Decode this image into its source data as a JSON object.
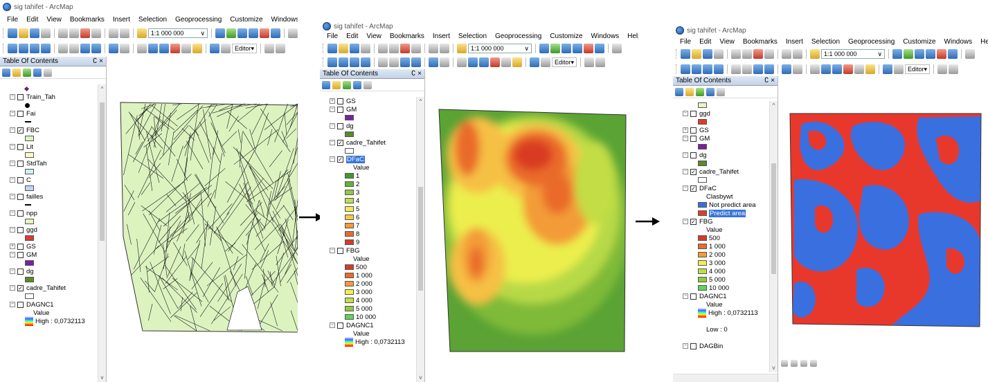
{
  "common": {
    "menu": [
      "File",
      "Edit",
      "View",
      "Bookmarks",
      "Insert",
      "Selection",
      "Geoprocessing",
      "Customize",
      "Windows",
      "Help"
    ],
    "scale": "1:1 000 000",
    "editor": "Editor▾",
    "toc_title": "Table Of Contents",
    "toc_pin": "∁ ×"
  },
  "windows": [
    {
      "title": "sig tahifet - ArcMap",
      "layers": [
        {
          "kind": "sym",
          "sym": "diamond"
        },
        {
          "kind": "layer",
          "pm": "−",
          "checked": false,
          "name": "Train_Tah"
        },
        {
          "kind": "sym",
          "sym": "dot"
        },
        {
          "kind": "layer",
          "pm": "−",
          "checked": false,
          "name": "Fai"
        },
        {
          "kind": "sym",
          "sym": "line"
        },
        {
          "kind": "layer",
          "pm": "−",
          "checked": true,
          "name": "FBC"
        },
        {
          "kind": "sym",
          "color": "#dcf3c0"
        },
        {
          "kind": "layer",
          "pm": "−",
          "checked": false,
          "name": "Lit"
        },
        {
          "kind": "sym",
          "color": "#fdfcc8"
        },
        {
          "kind": "layer",
          "pm": "−",
          "checked": false,
          "name": "StdTah"
        },
        {
          "kind": "sym",
          "color": "#cdeef6"
        },
        {
          "kind": "layer",
          "pm": "−",
          "checked": false,
          "name": "C"
        },
        {
          "kind": "sym",
          "color": "#bcd7f5"
        },
        {
          "kind": "layer",
          "pm": "−",
          "checked": false,
          "name": "failles"
        },
        {
          "kind": "sym",
          "sym": "line"
        },
        {
          "kind": "layer",
          "pm": "−",
          "checked": false,
          "name": "npp"
        },
        {
          "kind": "sym",
          "color": "#e6f4c0"
        },
        {
          "kind": "layer",
          "pm": "−",
          "checked": false,
          "name": "ggd"
        },
        {
          "kind": "sym",
          "color": "#e03a2e"
        },
        {
          "kind": "layer",
          "pm": "+",
          "checked": false,
          "name": "GS"
        },
        {
          "kind": "layer",
          "pm": "−",
          "checked": false,
          "name": "GM"
        },
        {
          "kind": "sym",
          "color": "#7b1fa2"
        },
        {
          "kind": "layer",
          "pm": "−",
          "checked": false,
          "name": "dg"
        },
        {
          "kind": "sym",
          "color": "#5a8a2a"
        },
        {
          "kind": "layer",
          "pm": "−",
          "checked": true,
          "name": "cadre_Tahifet"
        },
        {
          "kind": "sym",
          "color": "#ffffff"
        },
        {
          "kind": "layer",
          "pm": "−",
          "checked": false,
          "name": "DAGNC1"
        },
        {
          "kind": "label",
          "name": "Value"
        },
        {
          "kind": "ramp",
          "name": "High : 0,0732113"
        }
      ]
    },
    {
      "title": "sig tahifet - ArcMap",
      "layers": [
        {
          "kind": "layer",
          "pm": "+",
          "checked": false,
          "name": "GS"
        },
        {
          "kind": "layer",
          "pm": "−",
          "checked": false,
          "name": "GM"
        },
        {
          "kind": "sym",
          "color": "#7b1fa2"
        },
        {
          "kind": "layer",
          "pm": "−",
          "checked": false,
          "name": "dg"
        },
        {
          "kind": "sym",
          "color": "#5a8a2a"
        },
        {
          "kind": "layer",
          "pm": "−",
          "checked": true,
          "name": "cadre_Tahifet"
        },
        {
          "kind": "sym",
          "color": "#ffffff"
        },
        {
          "kind": "layer",
          "pm": "−",
          "checked": true,
          "name": "DFaC",
          "selected": true
        },
        {
          "kind": "label",
          "name": "Value"
        },
        {
          "kind": "class",
          "color": "#3f9b2a",
          "name": "1"
        },
        {
          "kind": "class",
          "color": "#66b32e",
          "name": "2"
        },
        {
          "kind": "class",
          "color": "#93c93a",
          "name": "3"
        },
        {
          "kind": "class",
          "color": "#c2dd45",
          "name": "4"
        },
        {
          "kind": "class",
          "color": "#f3ef4e",
          "name": "5"
        },
        {
          "kind": "class",
          "color": "#f7c843",
          "name": "6"
        },
        {
          "kind": "class",
          "color": "#f39b37",
          "name": "7"
        },
        {
          "kind": "class",
          "color": "#ea6a2c",
          "name": "8"
        },
        {
          "kind": "class",
          "color": "#d93a24",
          "name": "9"
        },
        {
          "kind": "layer",
          "pm": "−",
          "checked": false,
          "name": "FBG"
        },
        {
          "kind": "label",
          "name": "Value"
        },
        {
          "kind": "class",
          "color": "#d93a24",
          "name": "500"
        },
        {
          "kind": "class",
          "color": "#ea6a2c",
          "name": "1 000"
        },
        {
          "kind": "class",
          "color": "#f39b37",
          "name": "2 000"
        },
        {
          "kind": "class",
          "color": "#f3ef4e",
          "name": "3 000"
        },
        {
          "kind": "class",
          "color": "#c2dd45",
          "name": "4 000"
        },
        {
          "kind": "class",
          "color": "#93c93a",
          "name": "5 000"
        },
        {
          "kind": "class",
          "color": "#5fd35a",
          "name": "10 000"
        },
        {
          "kind": "layer",
          "pm": "−",
          "checked": false,
          "name": "DAGNC1"
        },
        {
          "kind": "label",
          "name": "Value"
        },
        {
          "kind": "ramp",
          "name": "High : 0,0732113"
        }
      ]
    },
    {
      "title": "sig tahifet - ArcMap",
      "layers": [
        {
          "kind": "sym",
          "color": "#e6f4c0"
        },
        {
          "kind": "layer",
          "pm": "−",
          "checked": false,
          "name": "ggd"
        },
        {
          "kind": "sym",
          "color": "#e03a2e"
        },
        {
          "kind": "layer",
          "pm": "+",
          "checked": false,
          "name": "GS"
        },
        {
          "kind": "layer",
          "pm": "−",
          "checked": false,
          "name": "GM"
        },
        {
          "kind": "sym",
          "color": "#7b1fa2"
        },
        {
          "kind": "layer",
          "pm": "−",
          "checked": false,
          "name": "dg"
        },
        {
          "kind": "sym",
          "color": "#5a8a2a"
        },
        {
          "kind": "layer",
          "pm": "−",
          "checked": true,
          "name": "cadre_Tahifet"
        },
        {
          "kind": "sym",
          "color": "#ffffff"
        },
        {
          "kind": "layer",
          "pm": "−",
          "checked": true,
          "name": "DFaC"
        },
        {
          "kind": "label",
          "name": "Clasbywt"
        },
        {
          "kind": "class",
          "color": "#3a6fe0",
          "name": "Not predict area"
        },
        {
          "kind": "class",
          "color": "#e8382c",
          "name": "Predict area",
          "selected": true
        },
        {
          "kind": "layer",
          "pm": "−",
          "checked": true,
          "name": "FBG"
        },
        {
          "kind": "label",
          "name": "Value"
        },
        {
          "kind": "class",
          "color": "#d93a24",
          "name": "500"
        },
        {
          "kind": "class",
          "color": "#ea6a2c",
          "name": "1 000"
        },
        {
          "kind": "class",
          "color": "#f39b37",
          "name": "2 000"
        },
        {
          "kind": "class",
          "color": "#f3ef4e",
          "name": "3 000"
        },
        {
          "kind": "class",
          "color": "#c2dd45",
          "name": "4 000"
        },
        {
          "kind": "class",
          "color": "#93c93a",
          "name": "5 000"
        },
        {
          "kind": "class",
          "color": "#5fd35a",
          "name": "10 000"
        },
        {
          "kind": "layer",
          "pm": "−",
          "checked": false,
          "name": "DAGNC1"
        },
        {
          "kind": "label",
          "name": "Value"
        },
        {
          "kind": "ramp",
          "name": "High : 0,0732113"
        },
        {
          "kind": "blank"
        },
        {
          "kind": "label",
          "name": "Low : 0"
        },
        {
          "kind": "blank"
        },
        {
          "kind": "layer",
          "pm": "−",
          "checked": false,
          "name": "DAGBin"
        }
      ]
    }
  ]
}
